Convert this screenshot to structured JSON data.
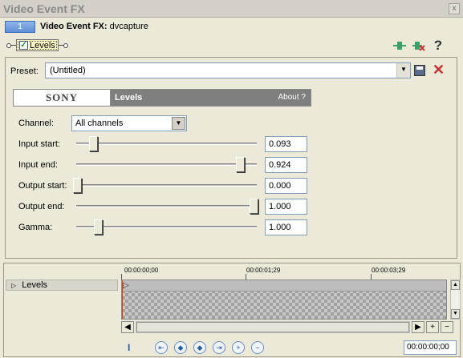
{
  "window": {
    "title": "Video Event FX",
    "close_glyph": "x"
  },
  "chain": {
    "number": "1",
    "title_bold": "Video Event FX:",
    "title_rest": "dvcapture"
  },
  "plugin_chip": {
    "label": "Levels",
    "checked": true
  },
  "toolbar": {
    "help_glyph": "?"
  },
  "preset": {
    "label": "Preset:",
    "value": "(Untitled)"
  },
  "banner": {
    "brand": "SONY",
    "plugin_name": "Levels",
    "about": "About  ?"
  },
  "params": {
    "channel": {
      "label": "Channel:",
      "value": "All channels"
    },
    "rows": [
      {
        "label": "Input start:",
        "value": "0.093",
        "level": 0.093
      },
      {
        "label": "Input end:",
        "value": "0.924",
        "level": 0.924
      },
      {
        "label": "Output start:",
        "value": "0.000",
        "level": 0.0
      },
      {
        "label": "Output end:",
        "value": "1.000",
        "level": 1.0
      },
      {
        "label": "Gamma:",
        "value": "1.000",
        "level": 0.12
      }
    ]
  },
  "timeline": {
    "track_label": "Levels",
    "ruler": [
      "00:00:00;00",
      "00:00:01;29",
      "00:00:03;29"
    ],
    "timecode": "00:00:00;00",
    "zoom_in": "+",
    "zoom_out": "−"
  },
  "colors": {
    "accent_blue": "#5f8fd8",
    "delete_red": "#c83030",
    "banner_gray": "#7f7f7f"
  }
}
